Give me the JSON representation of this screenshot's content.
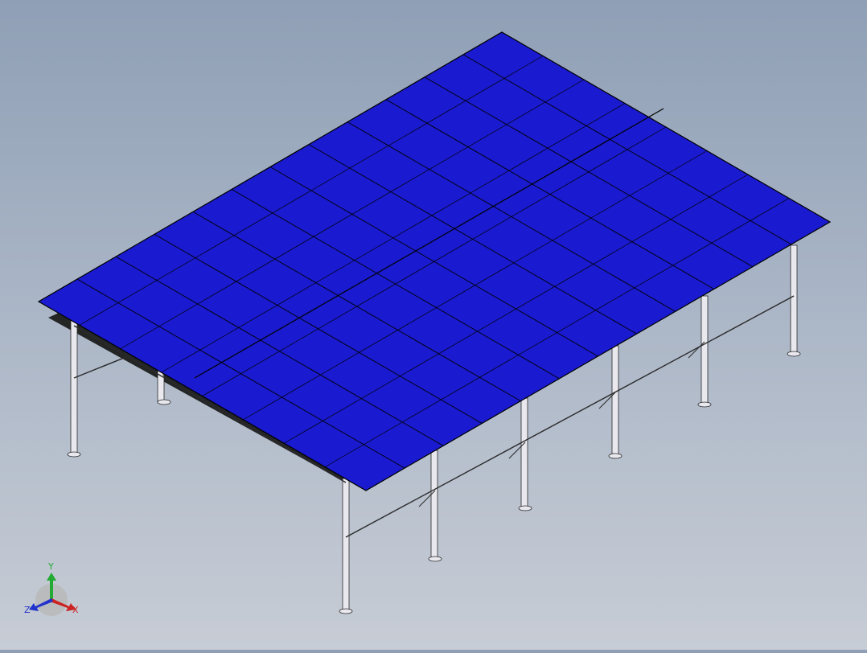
{
  "scene": {
    "panel_color": "#1a1ad0",
    "panel_edge_color": "#000000",
    "frame_color": "#e8e8ee",
    "frame_edge_color": "#2a2a2a",
    "shadow_color": "#1c1c1c"
  },
  "triad": {
    "y_label": "Y",
    "x_label": "X",
    "z_label": "Z",
    "y_color": "#22aa33",
    "x_color": "#cc2222",
    "z_color": "#2233cc"
  }
}
